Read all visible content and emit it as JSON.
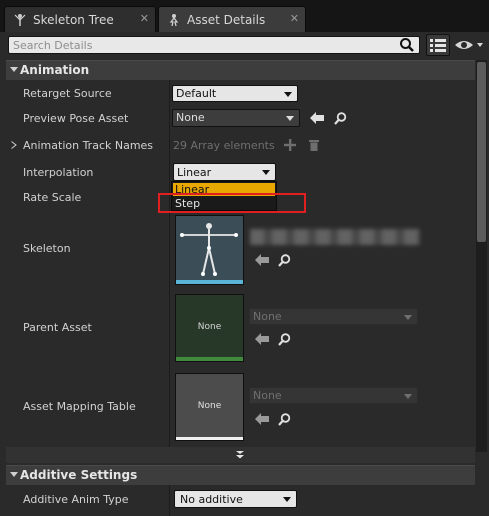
{
  "tabs": [
    {
      "label": "Skeleton Tree",
      "icon": "skeleton-icon"
    },
    {
      "label": "Asset Details",
      "icon": "asset-details-icon"
    }
  ],
  "search": {
    "placeholder": "Search Details"
  },
  "categories": {
    "animation": "Animation",
    "additive": "Additive Settings"
  },
  "rows": {
    "retarget_source": {
      "label": "Retarget Source",
      "value": "Default"
    },
    "preview_pose": {
      "label": "Preview Pose Asset",
      "value": "None"
    },
    "track_names": {
      "label": "Animation Track Names",
      "value": "29 Array elements"
    },
    "interpolation": {
      "label": "Interpolation",
      "value": "Linear"
    },
    "rate_scale": {
      "label": "Rate Scale"
    },
    "skeleton": {
      "label": "Skeleton"
    },
    "parent_asset": {
      "label": "Parent Asset",
      "thumb_text": "None",
      "value": "None"
    },
    "mapping_table": {
      "label": "Asset Mapping Table",
      "thumb_text": "None",
      "value": "None"
    },
    "additive_type": {
      "label": "Additive Anim Type",
      "value": "No additive"
    }
  },
  "interpolation_dropdown": {
    "options": [
      "Linear",
      "Step"
    ],
    "highlighted": "Linear"
  },
  "colors": {
    "highlight": "#e8a800",
    "annotation": "#e02020",
    "skeleton_bar": "#5ab4d6",
    "parent_bar": "#3f8a3f"
  }
}
